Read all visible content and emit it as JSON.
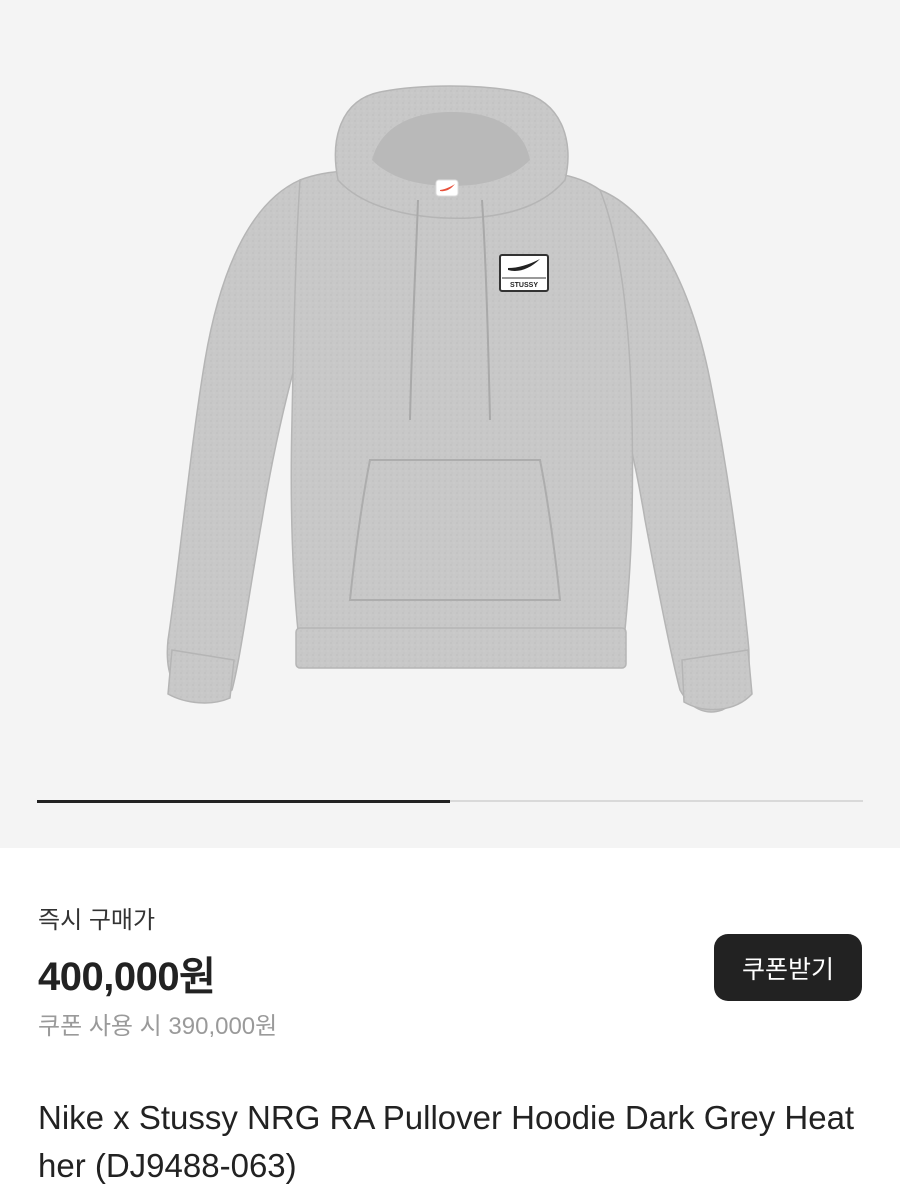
{
  "gallery": {
    "image_alt": "Grey pullover hoodie",
    "patch_text": "STUSSY",
    "progress_fraction": 0.5
  },
  "purchase": {
    "label": "즉시 구매가",
    "price": "400,000원",
    "coupon_price": "쿠폰 사용 시 390,000원",
    "coupon_button_label": "쿠폰받기"
  },
  "product": {
    "title": "Nike x Stussy NRG RA Pullover Hoodie Dark Grey Heather (DJ9488-063)"
  },
  "colors": {
    "hoodie": "#c9c9c9",
    "background": "#f4f4f4",
    "dark": "#222222",
    "muted": "#9a9a9a",
    "nike_red": "#e8503a"
  }
}
